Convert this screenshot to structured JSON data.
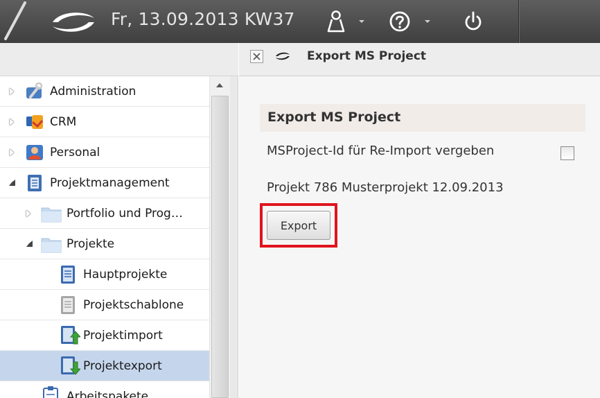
{
  "topbar": {
    "date_text": "Fr, 13.09.2013 KW37",
    "icons": [
      "logo-swoosh-icon",
      "user-icon",
      "help-icon",
      "power-icon"
    ]
  },
  "nav": {
    "items": [
      {
        "label": "Administration",
        "icon": "wrench-icon",
        "state": "collapsed",
        "level": 0
      },
      {
        "label": "CRM",
        "icon": "crm-icon",
        "state": "collapsed",
        "level": 0
      },
      {
        "label": "Personal",
        "icon": "person-icon",
        "state": "collapsed",
        "level": 0
      },
      {
        "label": "Projektmanagement",
        "icon": "project-icon",
        "state": "expanded",
        "level": 0
      },
      {
        "label": "Portfolio und Prog…",
        "icon": "folder-icon",
        "state": "collapsed",
        "level": 1
      },
      {
        "label": "Projekte",
        "icon": "folder-icon",
        "state": "expanded",
        "level": 1
      },
      {
        "label": "Hauptprojekte",
        "icon": "document-blue-icon",
        "state": "leaf",
        "level": 2
      },
      {
        "label": "Projektschablone",
        "icon": "document-grey-icon",
        "state": "leaf",
        "level": 2
      },
      {
        "label": "Projektimport",
        "icon": "import-icon",
        "state": "leaf",
        "level": 2
      },
      {
        "label": "Projektexport",
        "icon": "export-icon",
        "state": "leaf",
        "level": 2,
        "selected": true
      },
      {
        "label": "Arbeitspakete",
        "icon": "clipboard-icon",
        "state": "leaf",
        "level": 1
      }
    ]
  },
  "tab": {
    "title": "Export MS Project"
  },
  "form": {
    "section_title": "Export MS Project",
    "checkbox_label": "MSProject-Id für Re-Import vergeben",
    "checkbox_checked": false,
    "project_line": "Projekt 786 Musterprojekt 12.09.2013",
    "export_label": "Export"
  },
  "colors": {
    "topbar": "#4a4a4a",
    "selection": "#c5d6ec",
    "highlight": "#e0131e",
    "section_header": "#f1ece8"
  }
}
